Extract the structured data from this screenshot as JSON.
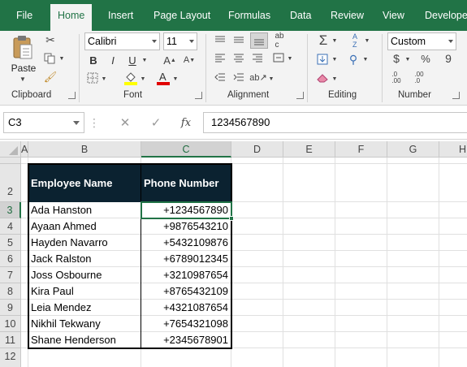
{
  "ribbon_tabs": [
    "File",
    "Home",
    "Insert",
    "Page Layout",
    "Formulas",
    "Data",
    "Review",
    "View",
    "Developer"
  ],
  "active_tab": "Home",
  "ribbon": {
    "clipboard": {
      "label": "Clipboard",
      "paste_label": "Paste"
    },
    "font": {
      "label": "Font",
      "font_name": "Calibri",
      "font_size": "11",
      "bold": "B",
      "italic": "I",
      "underline": "U"
    },
    "alignment": {
      "label": "Alignment"
    },
    "editing": {
      "label": "Editing"
    },
    "number": {
      "label": "Number",
      "format": "Custom",
      "currency": "$",
      "percent": "%",
      "comma": "9"
    }
  },
  "formula_bar": {
    "name_box": "C3",
    "fx": "fx",
    "value": "1234567890"
  },
  "columns": [
    "A",
    "B",
    "C",
    "D",
    "E",
    "F",
    "G",
    "H"
  ],
  "rows": [
    "1",
    "2",
    "3",
    "4",
    "5",
    "6",
    "7",
    "8",
    "9",
    "10",
    "11",
    "12"
  ],
  "table": {
    "headers": [
      "Employee Name",
      "Phone Number"
    ],
    "rows": [
      [
        "Ada Hanston",
        "+1234567890"
      ],
      [
        "Ayaan Ahmed",
        "+9876543210"
      ],
      [
        "Hayden Navarro",
        "+5432109876"
      ],
      [
        "Jack Ralston",
        "+6789012345"
      ],
      [
        "Joss Osbourne",
        "+3210987654"
      ],
      [
        "Kira Paul",
        "+8765432109"
      ],
      [
        "Leia Mendez",
        "+4321087654"
      ],
      [
        "Nikhil Tekwany",
        "+7654321098"
      ],
      [
        "Shane Henderson",
        "+2345678901"
      ]
    ]
  },
  "colors": {
    "excel_green": "#217346",
    "header_fill": "#0b2230",
    "fill_swatch": "#ffff00",
    "font_color_swatch": "#e00000"
  }
}
